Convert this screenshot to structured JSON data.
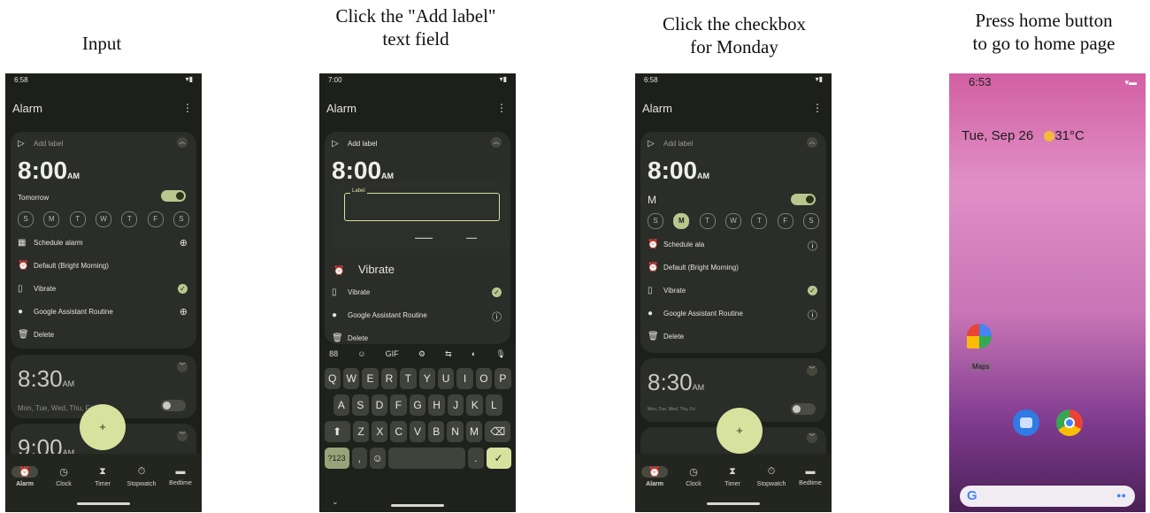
{
  "captions": [
    [
      "Input"
    ],
    [
      "Click the \"Add label\"",
      "text field"
    ],
    [
      "Click the checkbox",
      "for Monday"
    ],
    [
      "Press home button",
      "to go to home page"
    ]
  ],
  "screen1": {
    "status_time": "6:58",
    "app_title": "Alarm",
    "add_label": "Add label",
    "time": "8:00",
    "ampm": "AM",
    "repeat": "Tomorrow",
    "days": [
      "S",
      "M",
      "T",
      "W",
      "T",
      "F",
      "S"
    ],
    "schedule": "Schedule alarm",
    "ringtone": "Default (Bright Morning)",
    "vibrate": "Vibrate",
    "assistant": "Google Assistant Routine",
    "delete": "Delete",
    "alarm2_time": "8:30",
    "alarm2_ampm": "AM",
    "alarm2_days": "Mon, Tue, Wed, Thu, Fri",
    "alarm3_time": "9:00",
    "alarm3_ampm": "AM",
    "fab": "+",
    "nav": [
      "Alarm",
      "Clock",
      "Timer",
      "Stopwatch",
      "Bedtime"
    ]
  },
  "screen2": {
    "status_time": "7:00",
    "app_title": "Alarm",
    "add_label": "Add label",
    "time": "8:00",
    "ampm": "AM",
    "dialog_label": "Label",
    "vibrate_big": "Vibrate",
    "vibrate": "Vibrate",
    "assistant": "Google Assistant Routine",
    "delete": "Delete",
    "toolbar": [
      "88",
      "☺",
      "GIF",
      "⚙",
      "⇆",
      "◐",
      "🎙"
    ],
    "row1": [
      "Q",
      "W",
      "E",
      "R",
      "T",
      "Y",
      "U",
      "I",
      "O",
      "P"
    ],
    "row2": [
      "A",
      "S",
      "D",
      "F",
      "G",
      "H",
      "J",
      "K",
      "L"
    ],
    "row3": [
      "Z",
      "X",
      "C",
      "V",
      "B",
      "N",
      "M"
    ],
    "sym": "?123",
    "comma": ",",
    "period": "."
  },
  "screen3": {
    "status_time": "6:58",
    "app_title": "Alarm",
    "add_label": "Add label",
    "time": "8:00",
    "ampm": "AM",
    "repeat": "M",
    "days": [
      "S",
      "M",
      "T",
      "W",
      "T",
      "F",
      "S"
    ],
    "schedule": "Schedule ala",
    "ringtone": "Default (Bright Morning)",
    "vibrate": "Vibrate",
    "assistant": "Google Assistant Routine",
    "delete": "Delete",
    "alarm2_time": "8:30",
    "alarm2_ampm": "AM",
    "alarm2_days": "Mon, Tue, Wed, Thu, Fri",
    "fab": "+",
    "nav": [
      "Alarm",
      "Clock",
      "Timer",
      "Stopwatch",
      "Bedtime"
    ]
  },
  "screen4": {
    "status_time": "6:53",
    "date": "Tue, Sep 26",
    "temp": "31°C",
    "maps_label": "Maps",
    "google_g": "G"
  }
}
